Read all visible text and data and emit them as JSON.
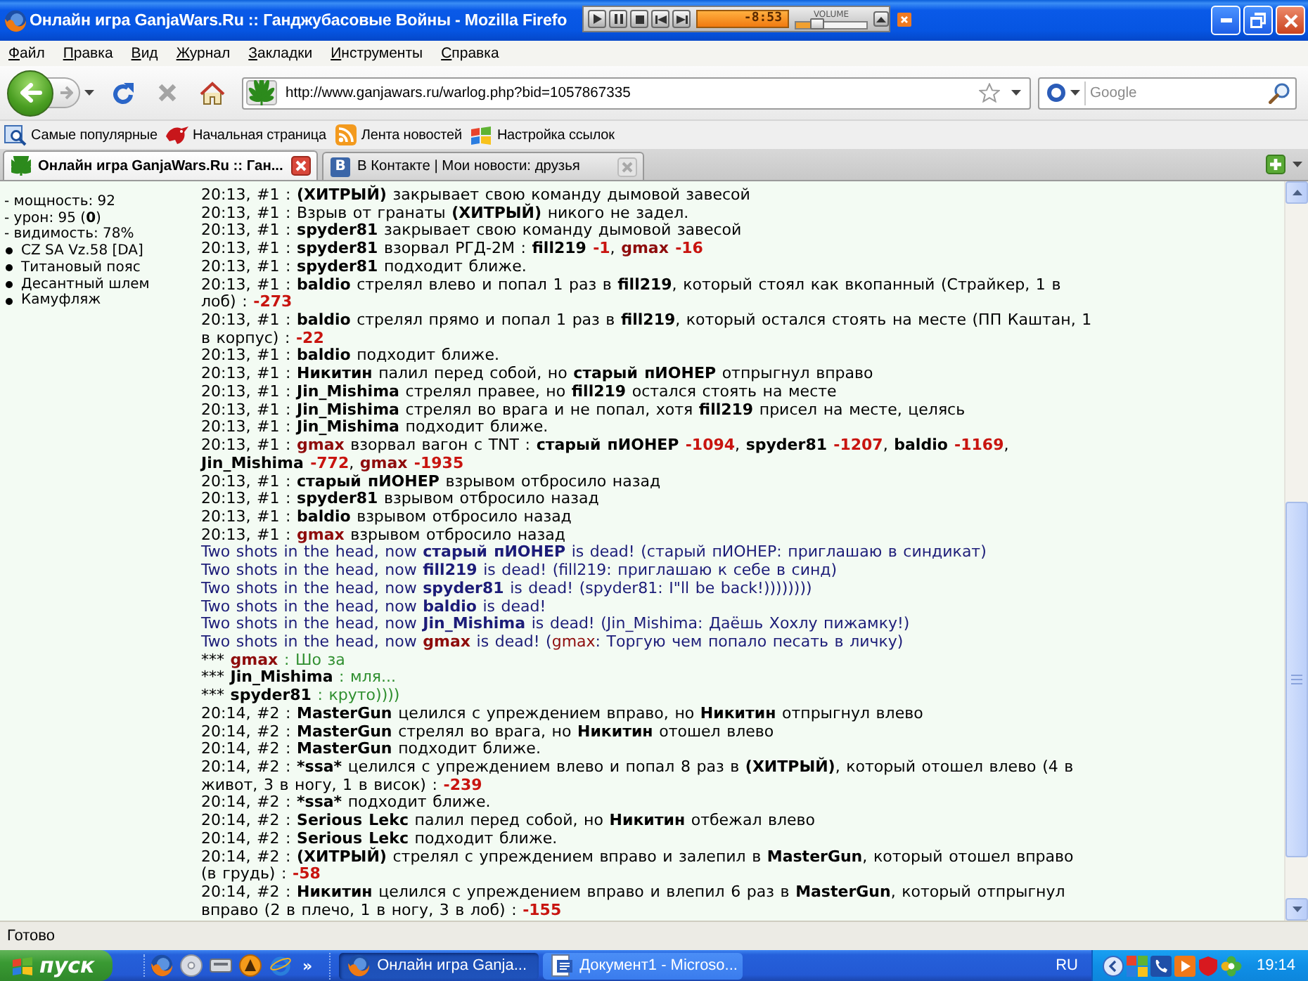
{
  "window": {
    "title": "Онлайн игра GanjaWars.Ru :: Ганджубасовые Войны - Mozilla Firefo"
  },
  "media_player": {
    "time": "-8:53",
    "volume_label": "VOLUME",
    "volume": {
      "level": 0.3
    }
  },
  "menu": [
    "Файл",
    "Правка",
    "Вид",
    "Журнал",
    "Закладки",
    "Инструменты",
    "Справка"
  ],
  "toolbar": {
    "address": "http://www.ganjawars.ru/warlog.php?bid=1057867335",
    "search": {
      "placeholder": "Google"
    }
  },
  "bookmarks": [
    "Самые популярные",
    "Начальная страница",
    "Лента новостей",
    "Настройка ссылок"
  ],
  "tabs": [
    {
      "label": "Онлайн игра GanjaWars.Ru :: Ган...",
      "selected": true
    },
    {
      "label": "В Контакте | Мои новости: друзья",
      "selected": false,
      "logo": "B"
    }
  ],
  "sidebar": {
    "stats": [
      "- мощность: 92",
      "- урон: 95 (**0**)",
      "- видимость: 78%"
    ],
    "equipment": [
      "CZ SA Vz.58 [DA]",
      "Титановый пояс",
      "Десантный шлем",
      "Камуфляж"
    ]
  },
  "log": [
    {
      "kind": "event",
      "parts": [
        "20:13, #1 : ",
        {
          "kind": "name",
          "text": "(ХИТРЫЙ)"
        },
        " закрывает свою команду дымовой завесой"
      ]
    },
    {
      "kind": "event",
      "parts": [
        "20:13, #1 : Взрыв от гранаты ",
        {
          "kind": "name",
          "text": "(ХИТРЫЙ)"
        },
        " никого не задел."
      ]
    },
    {
      "kind": "event",
      "parts": [
        "20:13, #1 : ",
        {
          "kind": "name",
          "text": "spyder81"
        },
        " закрывает свою команду дымовой завесой"
      ]
    },
    {
      "kind": "event",
      "parts": [
        "20:13, #1 : ",
        {
          "kind": "name",
          "text": "spyder81"
        },
        " взорвал РГД-2М : ",
        {
          "kind": "name",
          "text": "fill219"
        },
        {
          "kind": "damage",
          "text": " -1"
        },
        ", ",
        {
          "kind": "rival",
          "text": "gmax"
        },
        {
          "kind": "damage",
          "text": " -16"
        }
      ]
    },
    {
      "kind": "event",
      "parts": [
        "20:13, #1 : ",
        {
          "kind": "name",
          "text": "spyder81"
        },
        " подходит ближе."
      ]
    },
    {
      "kind": "event",
      "parts": [
        "20:13, #1 : ",
        {
          "kind": "name",
          "text": "baldio"
        },
        " стрелял влево и попал 1 раз в ",
        {
          "kind": "name",
          "text": "fill219"
        },
        ", который стоял как вкопанный (Страйкер, 1 в лоб) : ",
        {
          "kind": "damage",
          "text": "-273"
        }
      ]
    },
    {
      "kind": "event",
      "parts": [
        "20:13, #1 : ",
        {
          "kind": "name",
          "text": "baldio"
        },
        " стрелял прямо и попал 1 раз в ",
        {
          "kind": "name",
          "text": "fill219"
        },
        ", который остался стоять на месте (ПП Каштан, 1 в корпус) : ",
        {
          "kind": "damage",
          "text": "-22"
        }
      ]
    },
    {
      "kind": "event",
      "parts": [
        "20:13, #1 : ",
        {
          "kind": "name",
          "text": "baldio"
        },
        " подходит ближе."
      ]
    },
    {
      "kind": "event",
      "parts": [
        "20:13, #1 : ",
        {
          "kind": "name",
          "text": "Никитин"
        },
        " палил перед собой, но ",
        {
          "kind": "name",
          "text": "старый пИОНЕР"
        },
        " отпрыгнул вправо"
      ]
    },
    {
      "kind": "event",
      "parts": [
        "20:13, #1 : ",
        {
          "kind": "name",
          "text": "Jin_Mishima"
        },
        " стрелял правее, но ",
        {
          "kind": "name",
          "text": "fill219"
        },
        " остался стоять на месте"
      ]
    },
    {
      "kind": "event",
      "parts": [
        "20:13, #1 : ",
        {
          "kind": "name",
          "text": "Jin_Mishima"
        },
        " стрелял во врага и не попал, хотя ",
        {
          "kind": "name",
          "text": "fill219"
        },
        " присел на месте, целясь"
      ]
    },
    {
      "kind": "event",
      "parts": [
        "20:13, #1 : ",
        {
          "kind": "name",
          "text": "Jin_Mishima"
        },
        " подходит ближе."
      ]
    },
    {
      "kind": "event",
      "parts": [
        "20:13, #1 : ",
        {
          "kind": "rival",
          "text": "gmax"
        },
        " взорвал вагон с TNT : ",
        {
          "kind": "name",
          "text": "старый пИОНЕР"
        },
        {
          "kind": "damage",
          "text": " -1094"
        },
        ", ",
        {
          "kind": "name",
          "text": "spyder81"
        },
        {
          "kind": "damage",
          "text": " -1207"
        },
        ", ",
        {
          "kind": "name",
          "text": "baldio"
        },
        {
          "kind": "damage",
          "text": " -1169"
        },
        ", ",
        {
          "kind": "name",
          "text": "Jin_Mishima"
        },
        {
          "kind": "damage",
          "text": " -772"
        },
        ", ",
        {
          "kind": "rival",
          "text": "gmax"
        },
        {
          "kind": "damage",
          "text": " -1935"
        }
      ]
    },
    {
      "kind": "event",
      "parts": [
        "20:13, #1 : ",
        {
          "kind": "name",
          "text": "старый пИОНЕР"
        },
        " взрывом отбросило назад"
      ]
    },
    {
      "kind": "event",
      "parts": [
        "20:13, #1 : ",
        {
          "kind": "name",
          "text": "spyder81"
        },
        " взрывом отбросило назад"
      ]
    },
    {
      "kind": "event",
      "parts": [
        "20:13, #1 : ",
        {
          "kind": "name",
          "text": "baldio"
        },
        " взрывом отбросило назад"
      ]
    },
    {
      "kind": "event",
      "parts": [
        "20:13, #1 : ",
        {
          "kind": "rival",
          "text": "gmax"
        },
        " взрывом отбросило назад"
      ]
    },
    {
      "kind": "death",
      "parts": [
        "Two shots in the head, now ",
        {
          "kind": "name",
          "text": "старый пИОНЕР"
        },
        " is dead! (старый пИОНЕР: приглашаю в синдикат)"
      ]
    },
    {
      "kind": "death",
      "parts": [
        "Two shots in the head, now ",
        {
          "kind": "name",
          "text": "fill219"
        },
        " is dead! (fill219: приглашаю к себе в синд)"
      ]
    },
    {
      "kind": "death",
      "parts": [
        "Two shots in the head, now ",
        {
          "kind": "name",
          "text": "spyder81"
        },
        " is dead! (spyder81: I\"ll be back!))))))))"
      ]
    },
    {
      "kind": "death",
      "parts": [
        "Two shots in the head, now ",
        {
          "kind": "name",
          "text": "baldio"
        },
        " is dead!"
      ]
    },
    {
      "kind": "death",
      "parts": [
        "Two shots in the head, now ",
        {
          "kind": "name",
          "text": "Jin_Mishima"
        },
        " is dead! (Jin_Mishima: Даёшь Хохлу пижамку!)"
      ]
    },
    {
      "kind": "death",
      "parts": [
        "Two shots in the head, now ",
        {
          "kind": "rival",
          "text": "gmax"
        },
        " is dead! (",
        {
          "kind": "rival_mention",
          "text": "gmax"
        },
        ": Торгую чем попало песать в личку)"
      ]
    },
    {
      "kind": "chat",
      "parts": [
        "*** ",
        {
          "kind": "rival",
          "text": "gmax"
        },
        {
          "kind": "speech",
          "text": " : Шо за"
        }
      ]
    },
    {
      "kind": "chat",
      "parts": [
        "*** ",
        {
          "kind": "name",
          "text": "Jin_Mishima"
        },
        {
          "kind": "speech",
          "text": " : мля..."
        }
      ]
    },
    {
      "kind": "chat",
      "parts": [
        "*** ",
        {
          "kind": "name",
          "text": "spyder81"
        },
        {
          "kind": "speech",
          "text": " : круто))))"
        }
      ]
    },
    {
      "kind": "event",
      "parts": [
        "20:14, #2 : ",
        {
          "kind": "name",
          "text": "MasterGun"
        },
        " целился с упреждением вправо, но ",
        {
          "kind": "name",
          "text": "Никитин"
        },
        " отпрыгнул влево"
      ]
    },
    {
      "kind": "event",
      "parts": [
        "20:14, #2 : ",
        {
          "kind": "name",
          "text": "MasterGun"
        },
        " стрелял во врага, но ",
        {
          "kind": "name",
          "text": "Никитин"
        },
        " отошел влево"
      ]
    },
    {
      "kind": "event",
      "parts": [
        "20:14, #2 : ",
        {
          "kind": "name",
          "text": "MasterGun"
        },
        " подходит ближе."
      ]
    },
    {
      "kind": "event",
      "parts": [
        "20:14, #2 : ",
        {
          "kind": "name",
          "text": "*ssa*"
        },
        " целился с упреждением влево и попал 8 раз в ",
        {
          "kind": "name",
          "text": "(ХИТРЫЙ)"
        },
        ", который отошел влево (4 в живот, 3 в ногу, 1 в висок) : ",
        {
          "kind": "damage",
          "text": "-239"
        }
      ]
    },
    {
      "kind": "event",
      "parts": [
        "20:14, #2 : ",
        {
          "kind": "name",
          "text": "*ssa*"
        },
        " подходит ближе."
      ]
    },
    {
      "kind": "event",
      "parts": [
        "20:14, #2 : ",
        {
          "kind": "name",
          "text": "Serious Lekc"
        },
        " палил перед собой, но ",
        {
          "kind": "name",
          "text": "Никитин"
        },
        " отбежал влево"
      ]
    },
    {
      "kind": "event",
      "parts": [
        "20:14, #2 : ",
        {
          "kind": "name",
          "text": "Serious Lekc"
        },
        " подходит ближе."
      ]
    },
    {
      "kind": "event",
      "parts": [
        "20:14, #2 : ",
        {
          "kind": "name",
          "text": "(ХИТРЫЙ)"
        },
        " стрелял с упреждением вправо и залепил в ",
        {
          "kind": "name",
          "text": "MasterGun"
        },
        ", который отошел вправо (в грудь) : ",
        {
          "kind": "damage",
          "text": "-58"
        }
      ]
    },
    {
      "kind": "event",
      "parts": [
        "20:14, #2 : ",
        {
          "kind": "name",
          "text": "Никитин"
        },
        " целился с упреждением вправо и влепил 6 раз в ",
        {
          "kind": "name",
          "text": "MasterGun"
        },
        ", который отпрыгнул вправо (2 в плечо, 1 в ногу, 3 в лоб) : ",
        {
          "kind": "damage",
          "text": "-155"
        }
      ]
    }
  ],
  "status_bar": {
    "text": "Готово"
  },
  "taskbar": {
    "start": "пуск",
    "quick_launch_more": "»",
    "tasks": [
      {
        "label": "Онлайн игра Ganja...",
        "selected": true
      },
      {
        "label": "Документ1 - Microso...",
        "selected": false
      }
    ],
    "language": "RU",
    "clock": "19:14"
  }
}
